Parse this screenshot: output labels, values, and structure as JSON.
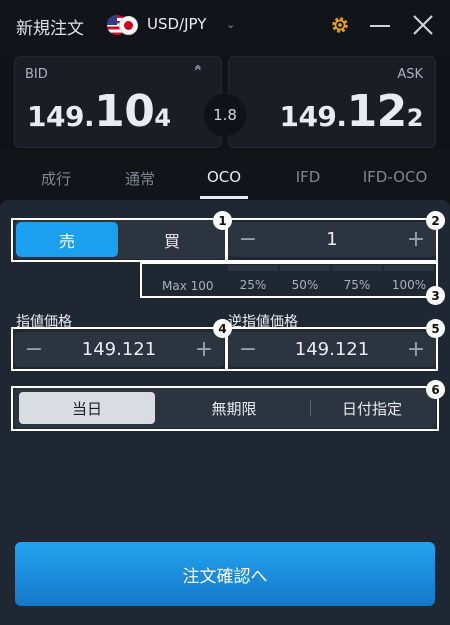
{
  "header": {
    "title": "新規注文",
    "pair": "USD/JPY"
  },
  "quotes": {
    "bid": {
      "label": "BID",
      "small": "149.",
      "big": "10",
      "last": "4"
    },
    "ask": {
      "label": "ASK",
      "small": "149.",
      "big": "12",
      "last": "2"
    },
    "spread": "1.8"
  },
  "order_tabs": [
    "成行",
    "通常",
    "OCO",
    "IFD",
    "IFD-OCO"
  ],
  "active_tab": "OCO",
  "side": {
    "sell": "売",
    "buy": "買",
    "selected": "sell"
  },
  "quantity": {
    "minus": "−",
    "value": "1",
    "plus": "+"
  },
  "quantity_presets": {
    "max": "Max 100",
    "options": [
      "25%",
      "50%",
      "75%",
      "100%"
    ]
  },
  "limit_price": {
    "label": "指値価格",
    "minus": "−",
    "value": "149.121",
    "plus": "+"
  },
  "stop_price": {
    "label": "逆指値価格",
    "minus": "−",
    "value": "149.121",
    "plus": "+"
  },
  "validity": {
    "options": [
      "当日",
      "無期限",
      "日付指定"
    ],
    "selected": "当日"
  },
  "annotations": [
    "1",
    "2",
    "3",
    "4",
    "5",
    "6"
  ],
  "confirm_label": "注文確認へ",
  "colors": {
    "accent": "#1aa0ee",
    "panel": "#1f2733",
    "gear": "#e8a020"
  }
}
